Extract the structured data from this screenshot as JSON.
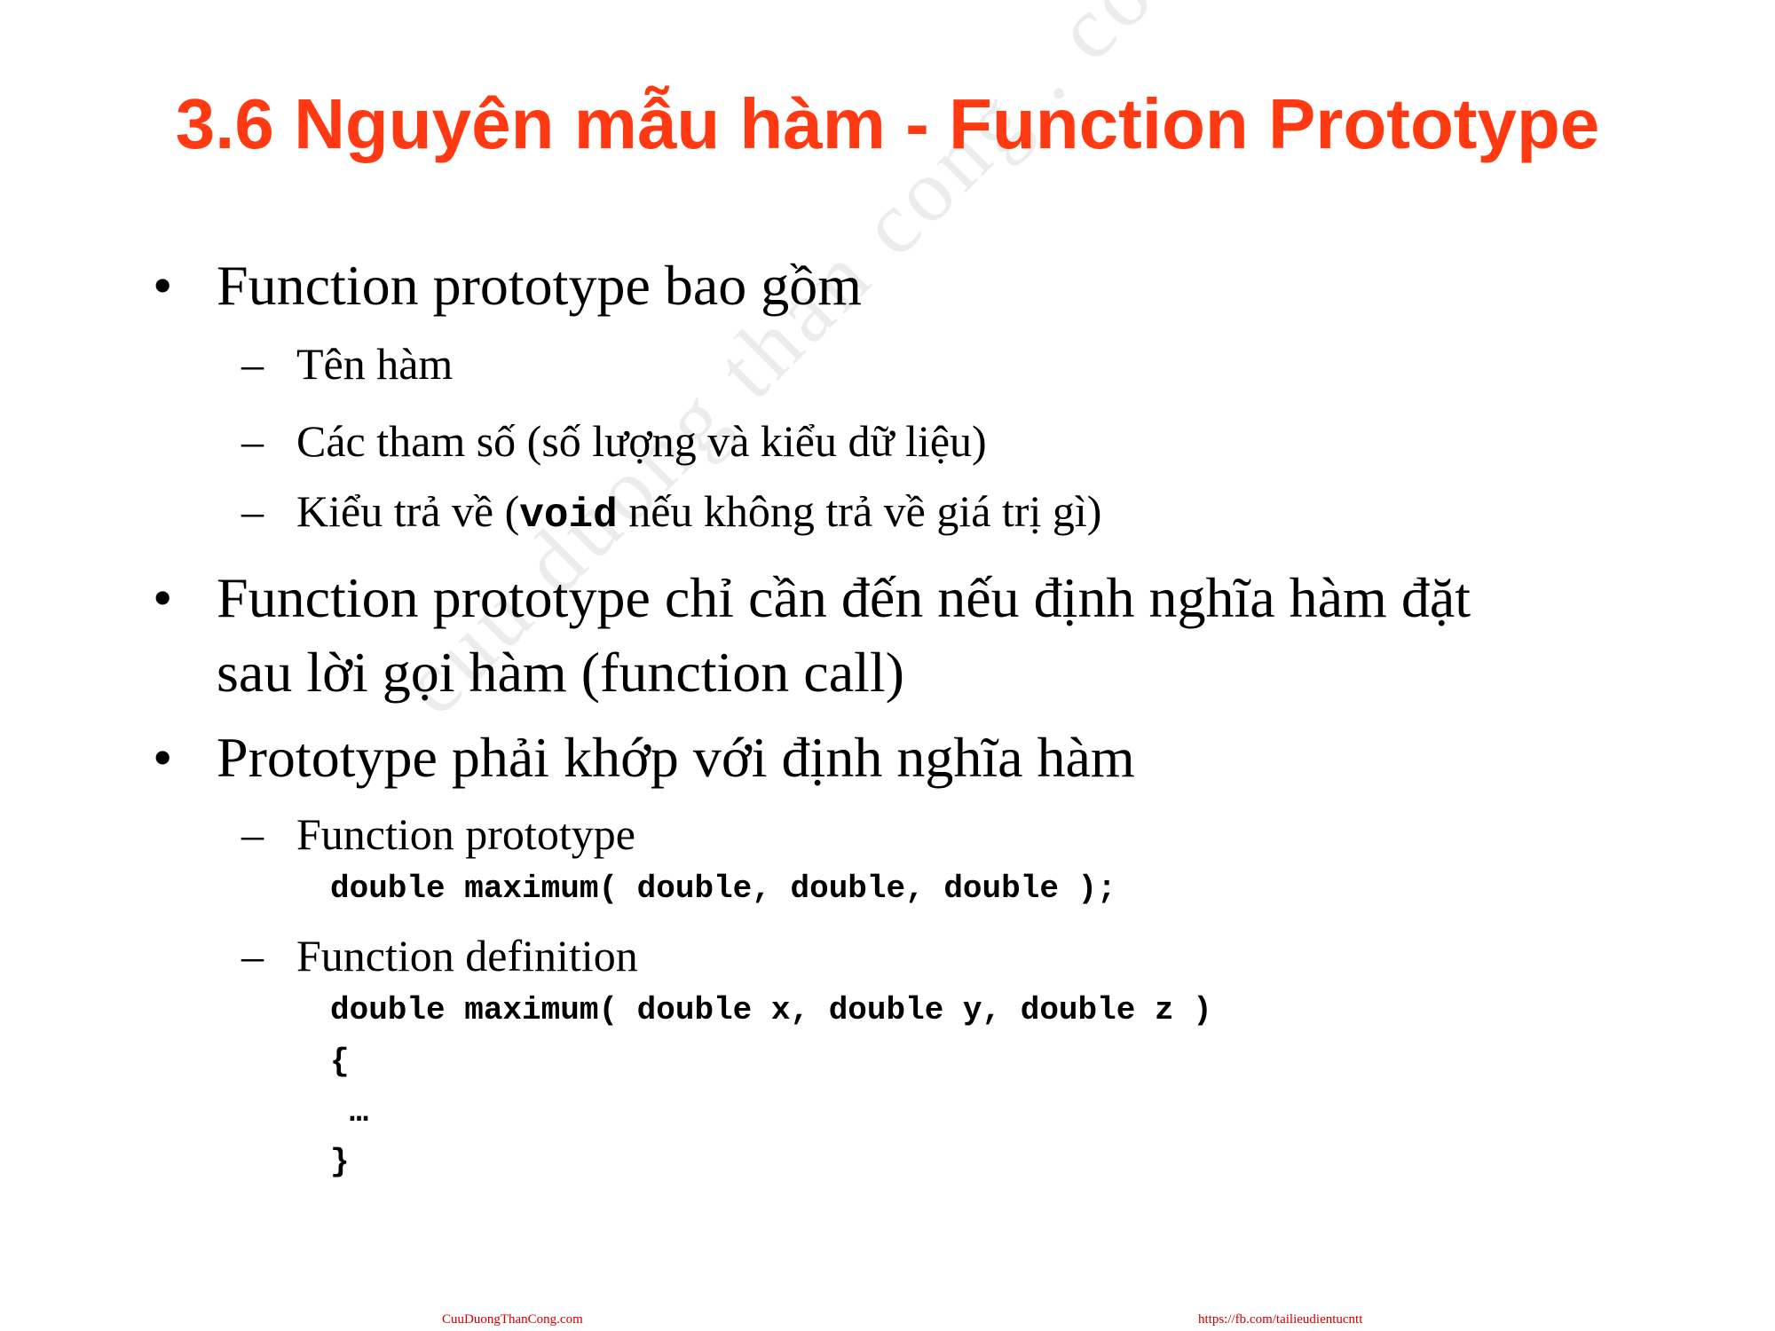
{
  "slide": {
    "title": "3.6 Nguyên mẫu hàm - Function Prototype",
    "watermark": "cuu duong than cong . com",
    "bullets": [
      {
        "marker": "•",
        "line1": "Function prototype bao gồm"
      },
      {
        "marker": "•",
        "line1": "Function prototype chỉ cần đến nếu định nghĩa hàm đặt",
        "line2": "sau lời gọi hàm (function call)"
      },
      {
        "marker": "•",
        "line1": "Prototype phải khớp với định nghĩa hàm"
      }
    ],
    "subitems": [
      {
        "marker": "–",
        "text": "Tên hàm"
      },
      {
        "marker": "–",
        "text": "Các tham số (số lượng và kiểu dữ liệu)"
      },
      {
        "marker": "–",
        "pre": "Kiểu trả về (",
        "code": "void",
        "post": " nếu không trả về giá trị gì)"
      },
      {
        "marker": "–",
        "text": "Function prototype"
      },
      {
        "marker": "–",
        "text": "Function definition"
      }
    ],
    "code": {
      "prototype": "double maximum( double, double, double );",
      "definition": [
        "double maximum( double x, double y, double z )",
        "{",
        " …",
        "}"
      ]
    },
    "footer": {
      "left": "CuuDuongThanCong.com",
      "right": "https://fb.com/tailieudientucntt"
    },
    "colors": {
      "title": "#ff3a12",
      "footer": "#cc0000",
      "watermark": "#ececec"
    }
  }
}
